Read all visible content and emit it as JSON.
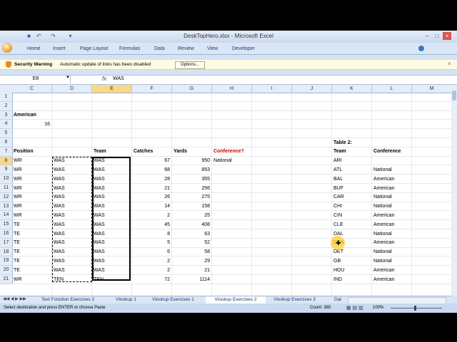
{
  "window": {
    "title": "DeskTopHero.xlsx - Microsoft Excel"
  },
  "ribbon": {
    "tabs": [
      "Home",
      "Insert",
      "Page Layout",
      "Formulas",
      "Data",
      "Review",
      "View",
      "Developer"
    ]
  },
  "security": {
    "label": "Security Warning",
    "message": "Automatic update of links has been disabled",
    "options_label": "Options..."
  },
  "formula_bar": {
    "name_box": "E8",
    "fx": "fx",
    "value": "WAS"
  },
  "columns": [
    "C",
    "D",
    "E",
    "F",
    "G",
    "H",
    "I",
    "J",
    "K",
    "L",
    "M"
  ],
  "rows": [
    "1",
    "2",
    "3",
    "4",
    "5",
    "6",
    "7",
    "8",
    "9",
    "10",
    "11",
    "12",
    "13",
    "14",
    "15",
    "16",
    "17",
    "18",
    "19",
    "20",
    "21"
  ],
  "sheet": {
    "american_label": "American",
    "american_value": "16",
    "headers": {
      "position": "Position",
      "team": "Team",
      "catches": "Catches",
      "yards": "Yards",
      "conference": "Conference?"
    },
    "records": [
      {
        "pos": "WR",
        "team1": "WAS",
        "team2": "WAS",
        "catches": "67",
        "yards": "950",
        "conf": "National"
      },
      {
        "pos": "WR",
        "team1": "WAS",
        "team2": "WAS",
        "catches": "68",
        "yards": "853",
        "conf": ""
      },
      {
        "pos": "WR",
        "team1": "WAS",
        "team2": "WAS",
        "catches": "28",
        "yards": "355",
        "conf": ""
      },
      {
        "pos": "WR",
        "team1": "WAS",
        "team2": "WAS",
        "catches": "21",
        "yards": "256",
        "conf": ""
      },
      {
        "pos": "WR",
        "team1": "WAS",
        "team2": "WAS",
        "catches": "26",
        "yards": "275",
        "conf": ""
      },
      {
        "pos": "WR",
        "team1": "WAS",
        "team2": "WAS",
        "catches": "14",
        "yards": "158",
        "conf": ""
      },
      {
        "pos": "WR",
        "team1": "WAS",
        "team2": "WAS",
        "catches": "2",
        "yards": "25",
        "conf": ""
      },
      {
        "pos": "TE",
        "team1": "WAS",
        "team2": "WAS",
        "catches": "45",
        "yards": "408",
        "conf": ""
      },
      {
        "pos": "TE",
        "team1": "WAS",
        "team2": "WAS",
        "catches": "8",
        "yards": "63",
        "conf": ""
      },
      {
        "pos": "TE",
        "team1": "WAS",
        "team2": "WAS",
        "catches": "5",
        "yards": "52",
        "conf": ""
      },
      {
        "pos": "TE",
        "team1": "WAS",
        "team2": "WAS",
        "catches": "6",
        "yards": "58",
        "conf": ""
      },
      {
        "pos": "TE",
        "team1": "WAS",
        "team2": "WAS",
        "catches": "2",
        "yards": "29",
        "conf": ""
      },
      {
        "pos": "TE",
        "team1": "WAS",
        "team2": "WAS",
        "catches": "2",
        "yards": "21",
        "conf": ""
      },
      {
        "pos": "WR",
        "team1": "TEN",
        "team2": "TEN",
        "catches": "72",
        "yards": "1114",
        "conf": ""
      }
    ],
    "table2": {
      "title": "Table 2:",
      "team_header": "Team",
      "conf_header": "Conference",
      "rows": [
        {
          "team": "ARI",
          "conf": ""
        },
        {
          "team": "ATL",
          "conf": "National"
        },
        {
          "team": "BAL",
          "conf": "American"
        },
        {
          "team": "BUF",
          "conf": "American"
        },
        {
          "team": "CAR",
          "conf": "National"
        },
        {
          "team": "CHI",
          "conf": "National"
        },
        {
          "team": "CIN",
          "conf": "American"
        },
        {
          "team": "CLE",
          "conf": "American"
        },
        {
          "team": "DAL",
          "conf": "National"
        },
        {
          "team": "DEN",
          "conf": "American"
        },
        {
          "team": "DET",
          "conf": "National"
        },
        {
          "team": "GB",
          "conf": "National"
        },
        {
          "team": "HOU",
          "conf": "American"
        },
        {
          "team": "IND",
          "conf": "American"
        }
      ]
    }
  },
  "sheet_tabs": [
    "Text Function Exercises 2",
    "Vlookup 1",
    "Vlookup Exercises 1",
    "Vlookup Exercises 2",
    "Vlookup Exercises 3",
    "Dat"
  ],
  "status": {
    "message": "Select destination and press ENTER or choose Paste",
    "count": "Count: 365",
    "zoom": "100%"
  },
  "colors": {
    "accent": "#f8d889",
    "conference_header": "#cc0000"
  }
}
